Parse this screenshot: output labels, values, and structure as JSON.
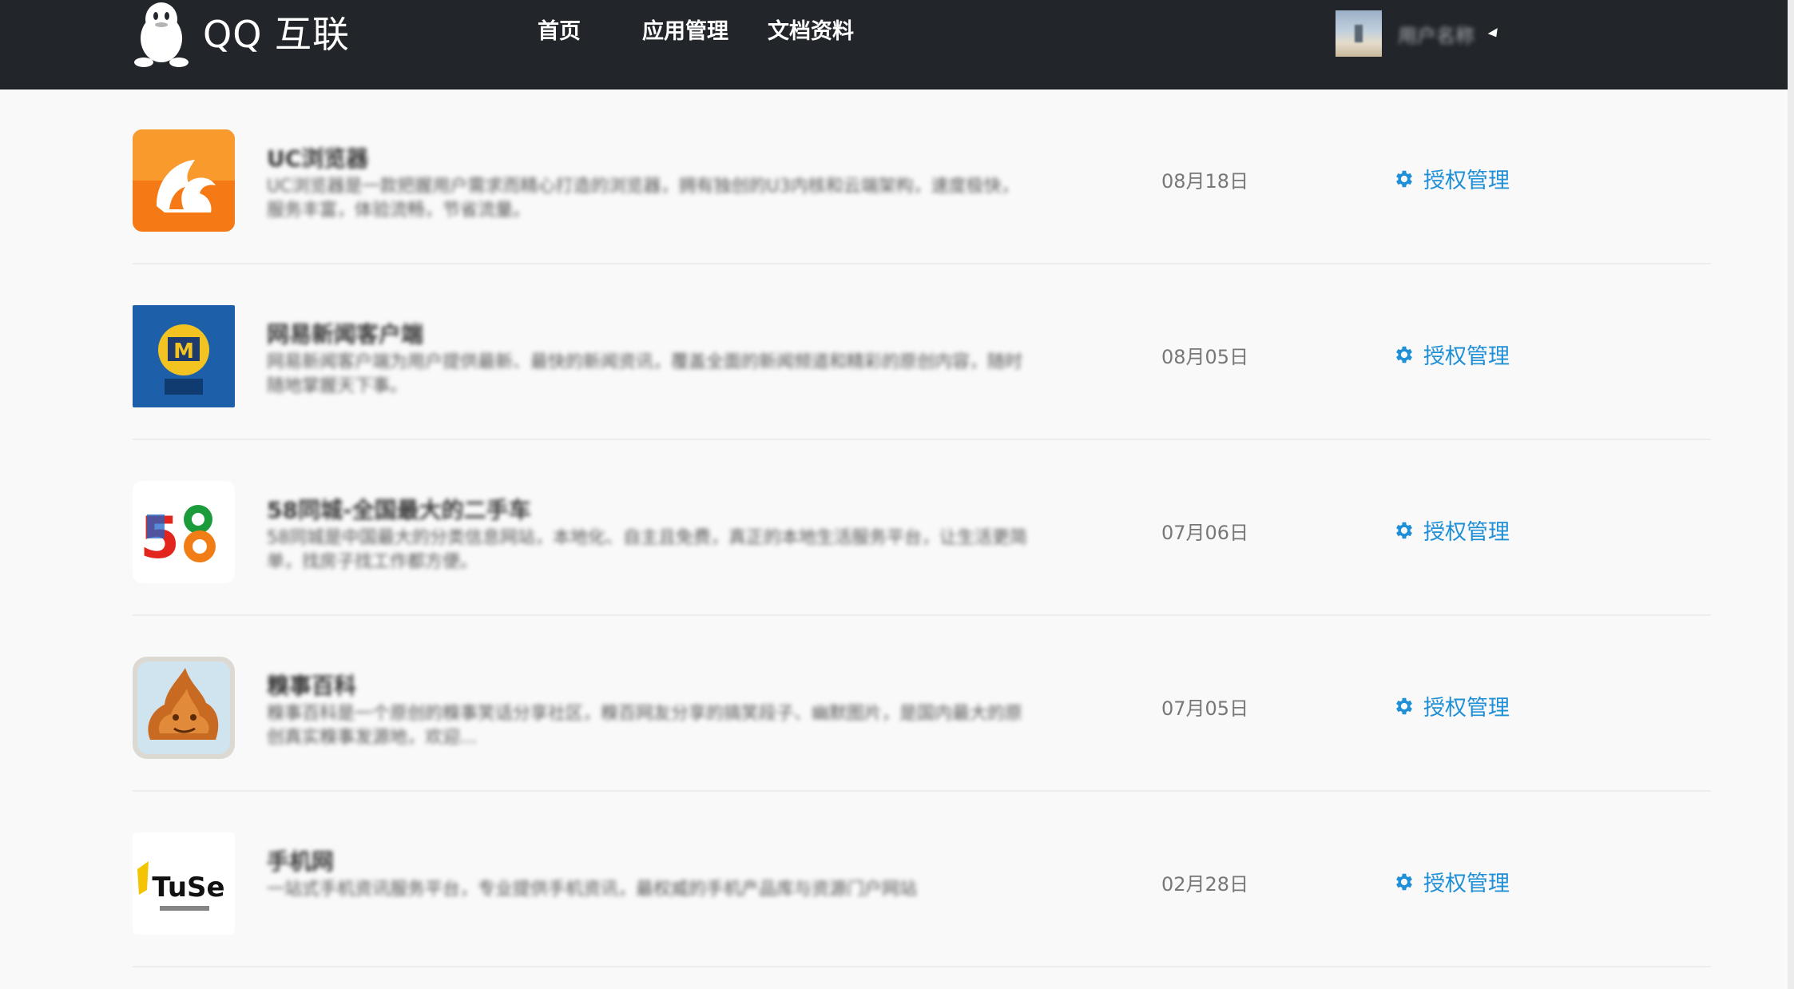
{
  "header": {
    "brand": "QQ 互联",
    "nav": [
      "首页",
      "应用管理",
      "文档资料"
    ],
    "user": {
      "name": "用户名称"
    }
  },
  "apps": [
    {
      "name": "UC浏览器",
      "description": "UC浏览器是一款把握用户需求而精心打造的浏览器，拥有独创的U3内核和云端架构，速度极快，服务丰富，体验流畅，节省流量。",
      "date": "08月18日",
      "action": "授权管理",
      "icon": "uc-browser-icon"
    },
    {
      "name": "网易新闻客户端",
      "description": "网易新闻客户端为用户提供最新、最快的新闻资讯，覆盖全面的新闻频道和精彩的原创内容，随时随地掌握天下事。",
      "date": "08月05日",
      "action": "授权管理",
      "icon": "news-app-icon"
    },
    {
      "name": "58同城-全国最大的二手车",
      "description": "58同城是中国最大的分类信息网站，本地化、自主且免费，真正的本地生活服务平台，让生活更简单，找房子找工作都方便。",
      "date": "07月06日",
      "action": "授权管理",
      "icon": "58-icon"
    },
    {
      "name": "糗事百科",
      "description": "糗事百科是一个原创的糗事笑话分享社区，糗百网友分享的搞笑段子、幽默图片，是国内最大的原创真实糗事发源地，欢迎...",
      "date": "07月05日",
      "action": "授权管理",
      "icon": "qiushi-icon"
    },
    {
      "name": "手机网",
      "description": "一站式手机资讯服务平台，专业提供手机资讯，最权威的手机产品库与资源门户网站",
      "date": "02月28日",
      "action": "授权管理",
      "icon": "tuse-icon"
    }
  ],
  "colors": {
    "topbar": "#22262b",
    "link": "#1f8fd6",
    "background": "#f9f9f9"
  }
}
